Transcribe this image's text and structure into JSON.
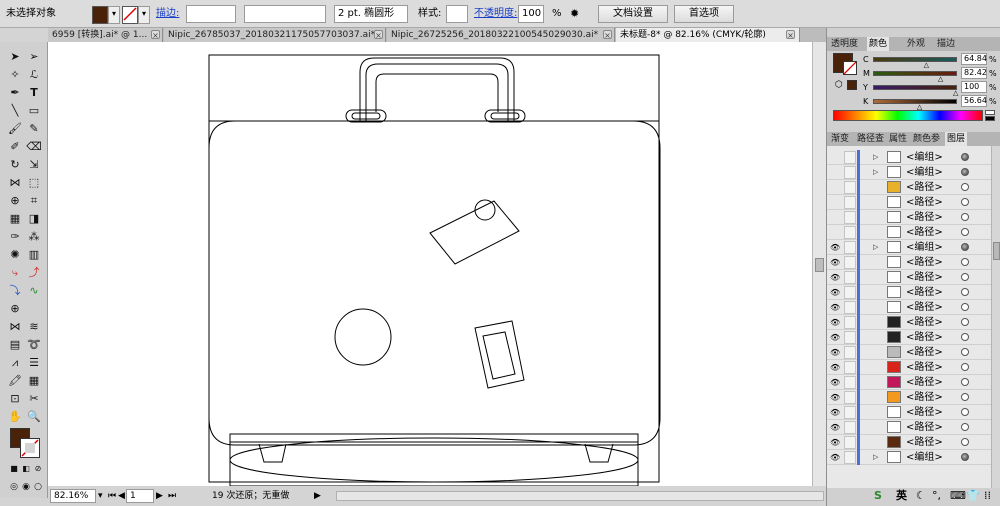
{
  "control_bar": {
    "selection_label": "未选择对象",
    "fill_color": "#4a2208",
    "stroke_label": "描边:",
    "stroke_weight": "",
    "brush_value": "2 pt. 椭圆形",
    "style_label": "样式:",
    "opacity_label": "不透明度:",
    "opacity_value": "100",
    "opacity_unit": "%",
    "doc_setup_button": "文档设置",
    "preferences_button": "首选项"
  },
  "tabs": [
    {
      "label": "6959 [转换].ai* @ 1..."
    },
    {
      "label": "Nipic_26785037_20180321175057703037.ai*"
    },
    {
      "label": "Nipic_26725256_20180322100545029030.ai*"
    },
    {
      "label": "未标题-8* @ 82.16% (CMYK/轮廓)"
    }
  ],
  "panel": {
    "top_tabs": [
      "透明度",
      "颜色",
      "外观",
      "描边"
    ],
    "color_swatch": "#4a2208",
    "cmyk": [
      {
        "letter": "C",
        "value": "64.84",
        "unit": "%",
        "frac": 0.65
      },
      {
        "letter": "M",
        "value": "82.42",
        "unit": "%",
        "frac": 0.82
      },
      {
        "letter": "Y",
        "value": "100",
        "unit": "%",
        "frac": 1.0
      },
      {
        "letter": "K",
        "value": "56.64",
        "unit": "%",
        "frac": 0.57
      }
    ],
    "layer_tabs": [
      "渐变",
      "路径查",
      "属性",
      "颜色参",
      "图层"
    ]
  },
  "layers": [
    {
      "name": "<编组>",
      "group": true,
      "visible": false,
      "thumb": "#ffffff"
    },
    {
      "name": "<编组>",
      "group": true,
      "visible": false,
      "thumb": "#ffffff"
    },
    {
      "name": "<路径>",
      "group": false,
      "visible": false,
      "thumb": "#e7b22a"
    },
    {
      "name": "<路径>",
      "group": false,
      "visible": false,
      "thumb": "#ffffff"
    },
    {
      "name": "<路径>",
      "group": false,
      "visible": false,
      "thumb": "#ffffff"
    },
    {
      "name": "<路径>",
      "group": false,
      "visible": false,
      "thumb": "#ffffff"
    },
    {
      "name": "<编组>",
      "group": true,
      "visible": true,
      "thumb": "#ffffff"
    },
    {
      "name": "<路径>",
      "group": false,
      "visible": true,
      "thumb": "#ffffff"
    },
    {
      "name": "<路径>",
      "group": false,
      "visible": true,
      "thumb": "#ffffff"
    },
    {
      "name": "<路径>",
      "group": false,
      "visible": true,
      "thumb": "#ffffff"
    },
    {
      "name": "<路径>",
      "group": false,
      "visible": true,
      "thumb": "#ffffff"
    },
    {
      "name": "<路径>",
      "group": false,
      "visible": true,
      "thumb": "#222222"
    },
    {
      "name": "<路径>",
      "group": false,
      "visible": true,
      "thumb": "#222222"
    },
    {
      "name": "<路径>",
      "group": false,
      "visible": true,
      "thumb": "#bbbbbb"
    },
    {
      "name": "<路径>",
      "group": false,
      "visible": true,
      "thumb": "#d9241c"
    },
    {
      "name": "<路径>",
      "group": false,
      "visible": true,
      "thumb": "#c2185b"
    },
    {
      "name": "<路径>",
      "group": false,
      "visible": true,
      "thumb": "#f39a1e"
    },
    {
      "name": "<路径>",
      "group": false,
      "visible": true,
      "thumb": "#ffffff"
    },
    {
      "name": "<路径>",
      "group": false,
      "visible": true,
      "thumb": "#ffffff"
    },
    {
      "name": "<路径>",
      "group": false,
      "visible": true,
      "thumb": "#5a2a10"
    },
    {
      "name": "<编组>",
      "group": true,
      "visible": true,
      "thumb": "#ffffff"
    }
  ],
  "status": {
    "zoom": "82.16%",
    "page": "1",
    "undo_text": "19 次还原；无重做"
  },
  "tray": {
    "ime_label": "英"
  }
}
